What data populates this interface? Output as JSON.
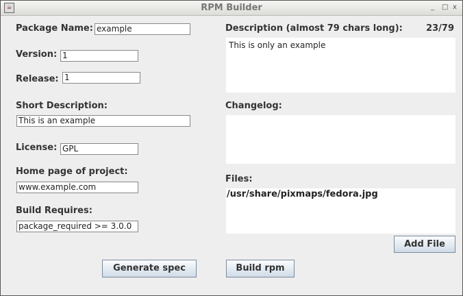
{
  "window": {
    "title": "RPM Builder",
    "minimize": "_",
    "maximize": "□",
    "close": "x"
  },
  "form": {
    "package_name_label": "Package Name:",
    "package_name": "example",
    "version_label": "Version:",
    "version": "1",
    "release_label": "Release:",
    "release": "1",
    "short_desc_label": "Short Description:",
    "short_desc": "This is an example",
    "license_label": "License:",
    "license": "GPL",
    "homepage_label": "Home page of project:",
    "homepage": "www.example.com",
    "build_requires_label": "Build Requires:",
    "build_requires": "package_required >= 3.0.0",
    "description_label": "Description (almost 79 chars long):",
    "description_count": "23/79",
    "description": "This is only an example",
    "changelog_label": "Changelog:",
    "changelog": "",
    "files_label": "Files:",
    "files": "/usr/share/pixmaps/fedora.jpg"
  },
  "buttons": {
    "add_file": "Add File",
    "generate_spec": "Generate spec",
    "build_rpm": "Build rpm"
  }
}
